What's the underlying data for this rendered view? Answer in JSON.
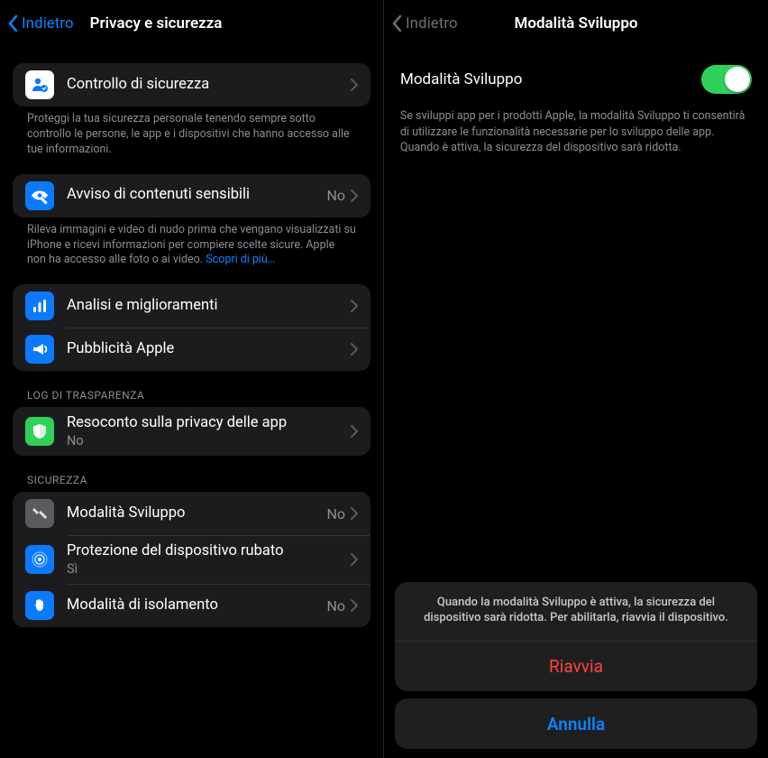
{
  "left": {
    "back": "Indietro",
    "title": "Privacy e sicurezza",
    "sections": {
      "safety_check": {
        "title": "Controllo di sicurezza",
        "footer": "Proteggi la tua sicurezza personale tenendo sempre sotto controllo le persone, le app e i dispositivi che hanno accesso alle tue informazioni."
      },
      "sensitive": {
        "title": "Avviso di contenuti sensibili",
        "value": "No",
        "footer_text": "Rileva immagini e video di nudo prima che vengano visualizzati su iPhone e ricevi informazioni per compiere scelte sicure. Apple non ha accesso alle foto o ai video.",
        "footer_link": "Scopri di più…"
      },
      "analytics": {
        "title": "Analisi e miglioramenti"
      },
      "advertising": {
        "title": "Pubblicità Apple"
      },
      "transparency_header": "LOG DI TRASPARENZA",
      "app_privacy": {
        "title": "Resoconto sulla privacy delle app",
        "value": "No"
      },
      "security_header": "SICUREZZA",
      "dev_mode": {
        "title": "Modalità Sviluppo",
        "value": "No"
      },
      "stolen": {
        "title": "Protezione del dispositivo rubato",
        "value": "Sì"
      },
      "lockdown": {
        "title": "Modalità di isolamento",
        "value": "No"
      }
    }
  },
  "right": {
    "back": "Indietro",
    "title": "Modalità Sviluppo",
    "toggle_label": "Modalità Sviluppo",
    "toggle_on": true,
    "desc": "Se sviluppi app per i prodotti Apple, la modalità Sviluppo ti consentirà di utilizzare le funzionalità necessarie per lo sviluppo delle app. Quando è attiva, la sicurezza del dispositivo sarà ridotta.",
    "sheet": {
      "message": "Quando la modalità Sviluppo è attiva, la sicurezza del dispositivo sarà ridotta. Per abilitarla, riavvia il dispositivo.",
      "restart": "Riavvia",
      "cancel": "Annulla"
    }
  }
}
